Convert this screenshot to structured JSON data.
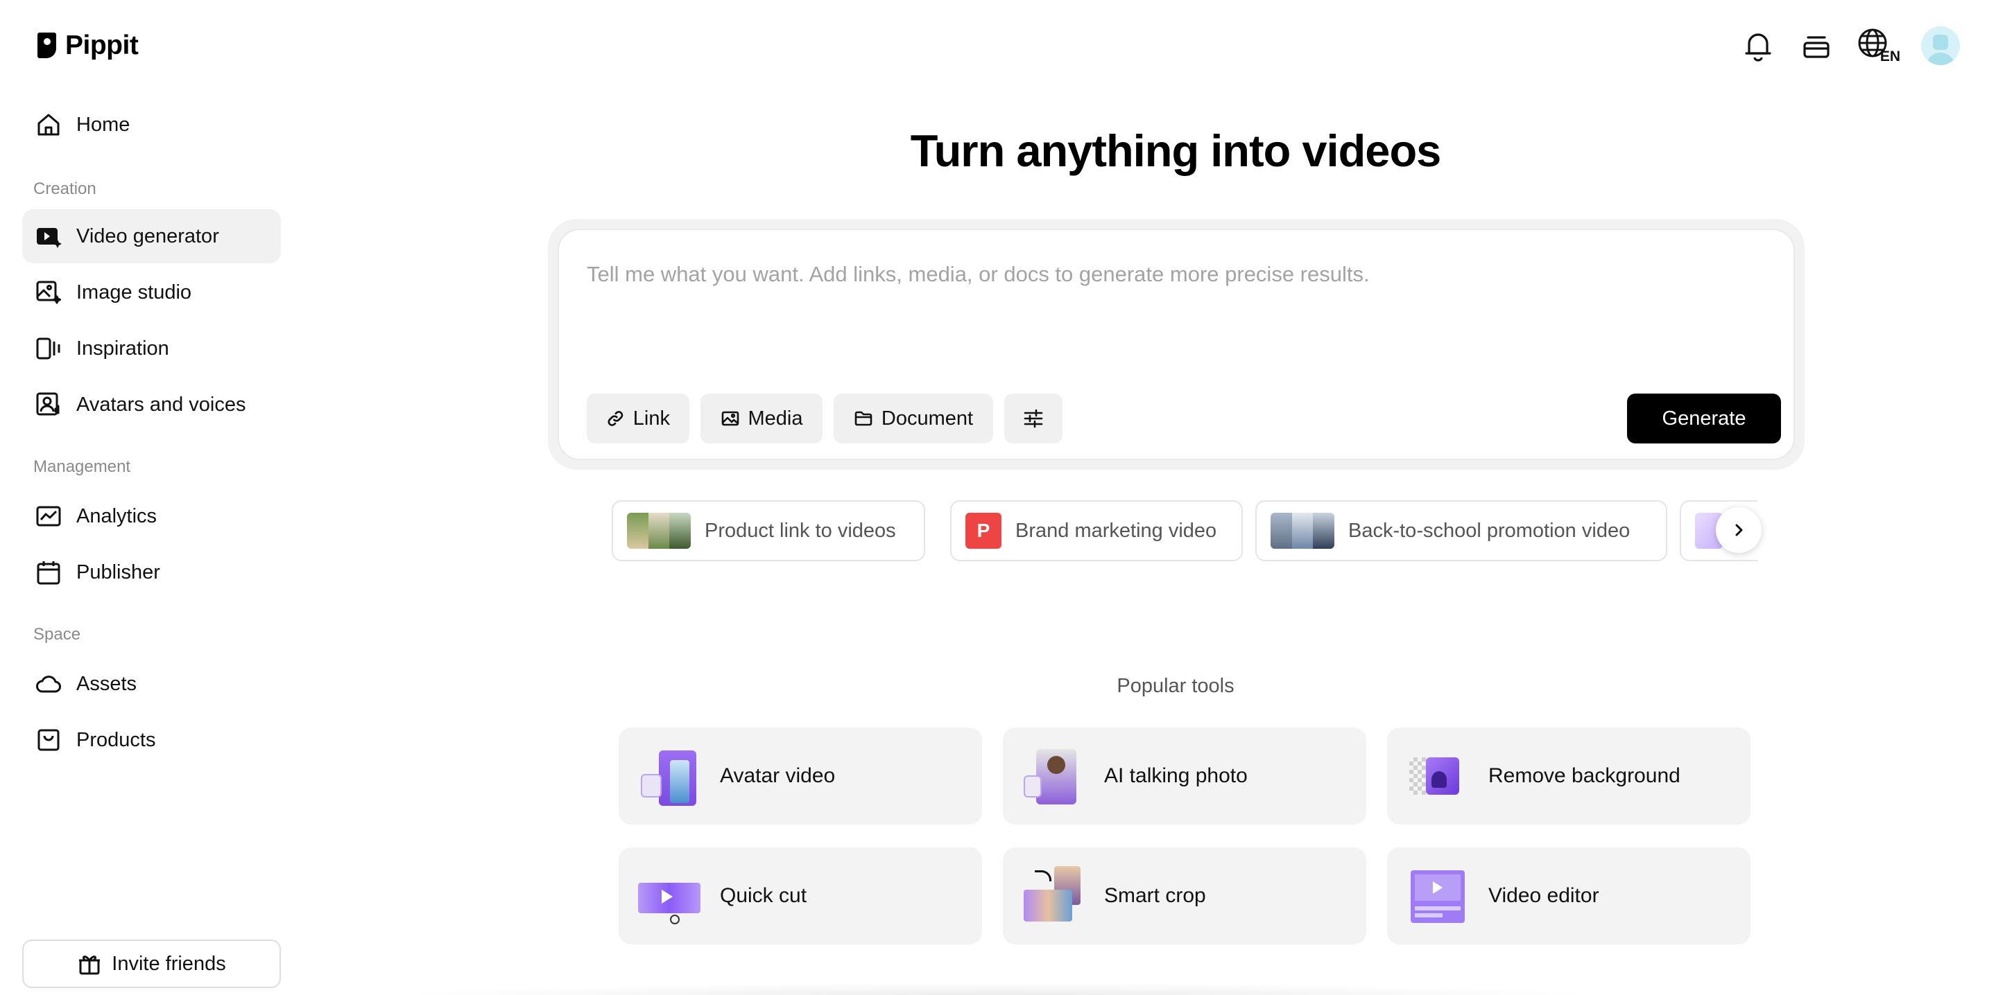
{
  "brand": {
    "name": "Pippit"
  },
  "sidebar": {
    "home": {
      "label": "Home",
      "icon": "home-icon"
    },
    "sections": {
      "creation": "Creation",
      "management": "Management",
      "space": "Space"
    },
    "creation_items": [
      {
        "label": "Video generator",
        "icon": "video-generator-icon",
        "active": true
      },
      {
        "label": "Image studio",
        "icon": "image-studio-icon"
      },
      {
        "label": "Inspiration",
        "icon": "inspiration-icon"
      },
      {
        "label": "Avatars and voices",
        "icon": "avatar-voice-icon"
      }
    ],
    "management_items": [
      {
        "label": "Analytics",
        "icon": "analytics-icon"
      },
      {
        "label": "Publisher",
        "icon": "calendar-icon"
      }
    ],
    "space_items": [
      {
        "label": "Assets",
        "icon": "cloud-icon"
      },
      {
        "label": "Products",
        "icon": "bag-icon"
      }
    ],
    "invite_label": "Invite friends"
  },
  "topbar": {
    "icons": [
      "bell-icon",
      "stack-icon",
      "globe-icon",
      "avatar"
    ],
    "language": "EN"
  },
  "main": {
    "headline": "Turn anything into videos",
    "prompt": {
      "placeholder": "Tell me what you want. Add links, media, or docs to generate more precise results.",
      "value": "",
      "buttons": {
        "link": "Link",
        "media": "Media",
        "document": "Document"
      },
      "settings_icon": "sliders-icon",
      "generate": "Generate"
    },
    "suggestions": [
      {
        "label": "Product link to videos"
      },
      {
        "label": "Brand marketing video",
        "badge": "P"
      },
      {
        "label": "Back-to-school promotion video"
      }
    ],
    "popular_title": "Popular tools",
    "tools": [
      {
        "label": "Avatar video"
      },
      {
        "label": "AI talking photo"
      },
      {
        "label": "Remove background"
      },
      {
        "label": "Quick cut"
      },
      {
        "label": "Smart crop"
      },
      {
        "label": "Video editor"
      }
    ]
  },
  "colors": {
    "accent_purple": "#8b5cf6",
    "primary_button": "#000000",
    "badge_red": "#ef4444"
  }
}
